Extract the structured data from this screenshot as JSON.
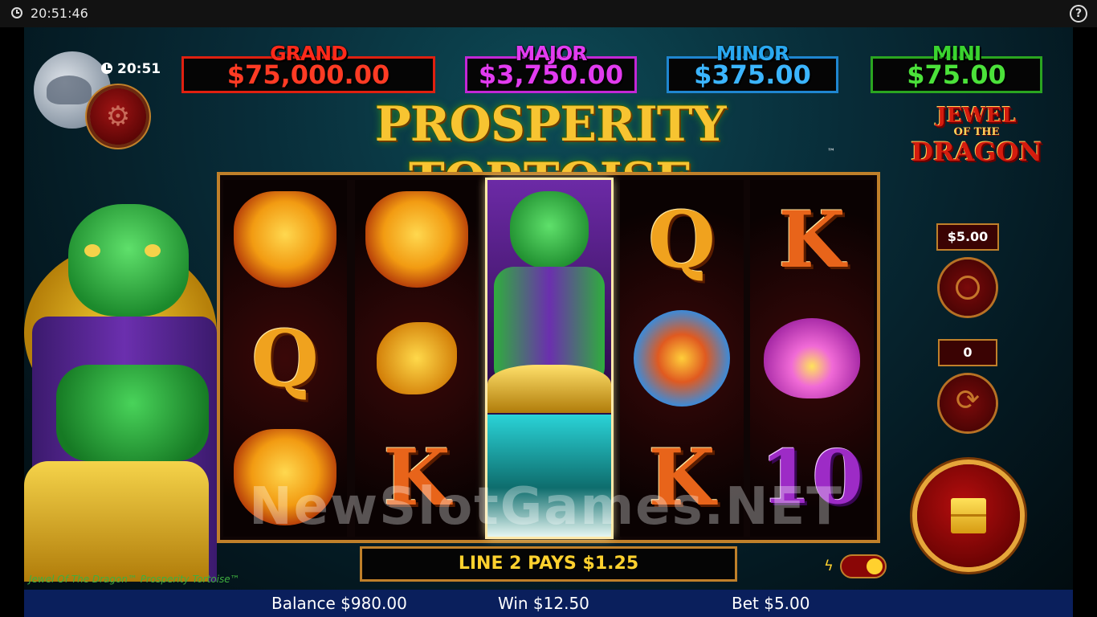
{
  "system_bar": {
    "time": "20:51:46",
    "help_label": "?"
  },
  "hud": {
    "clock": "20:51"
  },
  "jackpots": [
    {
      "label": "GRAND",
      "value": "$75,000.00",
      "label_color": "#ff2a1a",
      "value_color": "#ff3b24",
      "border_color": "#e02010"
    },
    {
      "label": "MAJOR",
      "value": "$3,750.00",
      "label_color": "#e23bf0",
      "value_color": "#e23bf0",
      "border_color": "#c327d6"
    },
    {
      "label": "MINOR",
      "value": "$375.00",
      "label_color": "#29a8f0",
      "value_color": "#3bb5ff",
      "border_color": "#1f86d0"
    },
    {
      "label": "MINI",
      "value": "$75.00",
      "label_color": "#3ad42f",
      "value_color": "#4be23a",
      "border_color": "#2aa520"
    }
  ],
  "title": "PROSPERITY TORTOISE",
  "trademark": "™",
  "logo": {
    "line1": "JEWEL",
    "line2": "OF THE",
    "line3": "DRAGON"
  },
  "reels": [
    [
      "phoenix",
      "Q",
      "phoenix"
    ],
    [
      "phoenix",
      "fish",
      "K"
    ],
    [
      "wild-tortoise"
    ],
    [
      "Q",
      "tortoise-stack",
      "K"
    ],
    [
      "K",
      "lotus",
      "10"
    ]
  ],
  "symbols_text": {
    "Q": "Q",
    "K": "K",
    "10": "10"
  },
  "controls": {
    "stake": "$5.00",
    "autoplay_count": "0",
    "turbo_on": true
  },
  "message": "LINE 2 PAYS $1.25",
  "watermark": "NewSlotGames.NET",
  "game_title": "Jewel Of The Dragon™ Prosperity Tortoise™",
  "footer": {
    "balance": "Balance $980.00",
    "win": "Win $12.50",
    "bet": "Bet $5.00"
  }
}
